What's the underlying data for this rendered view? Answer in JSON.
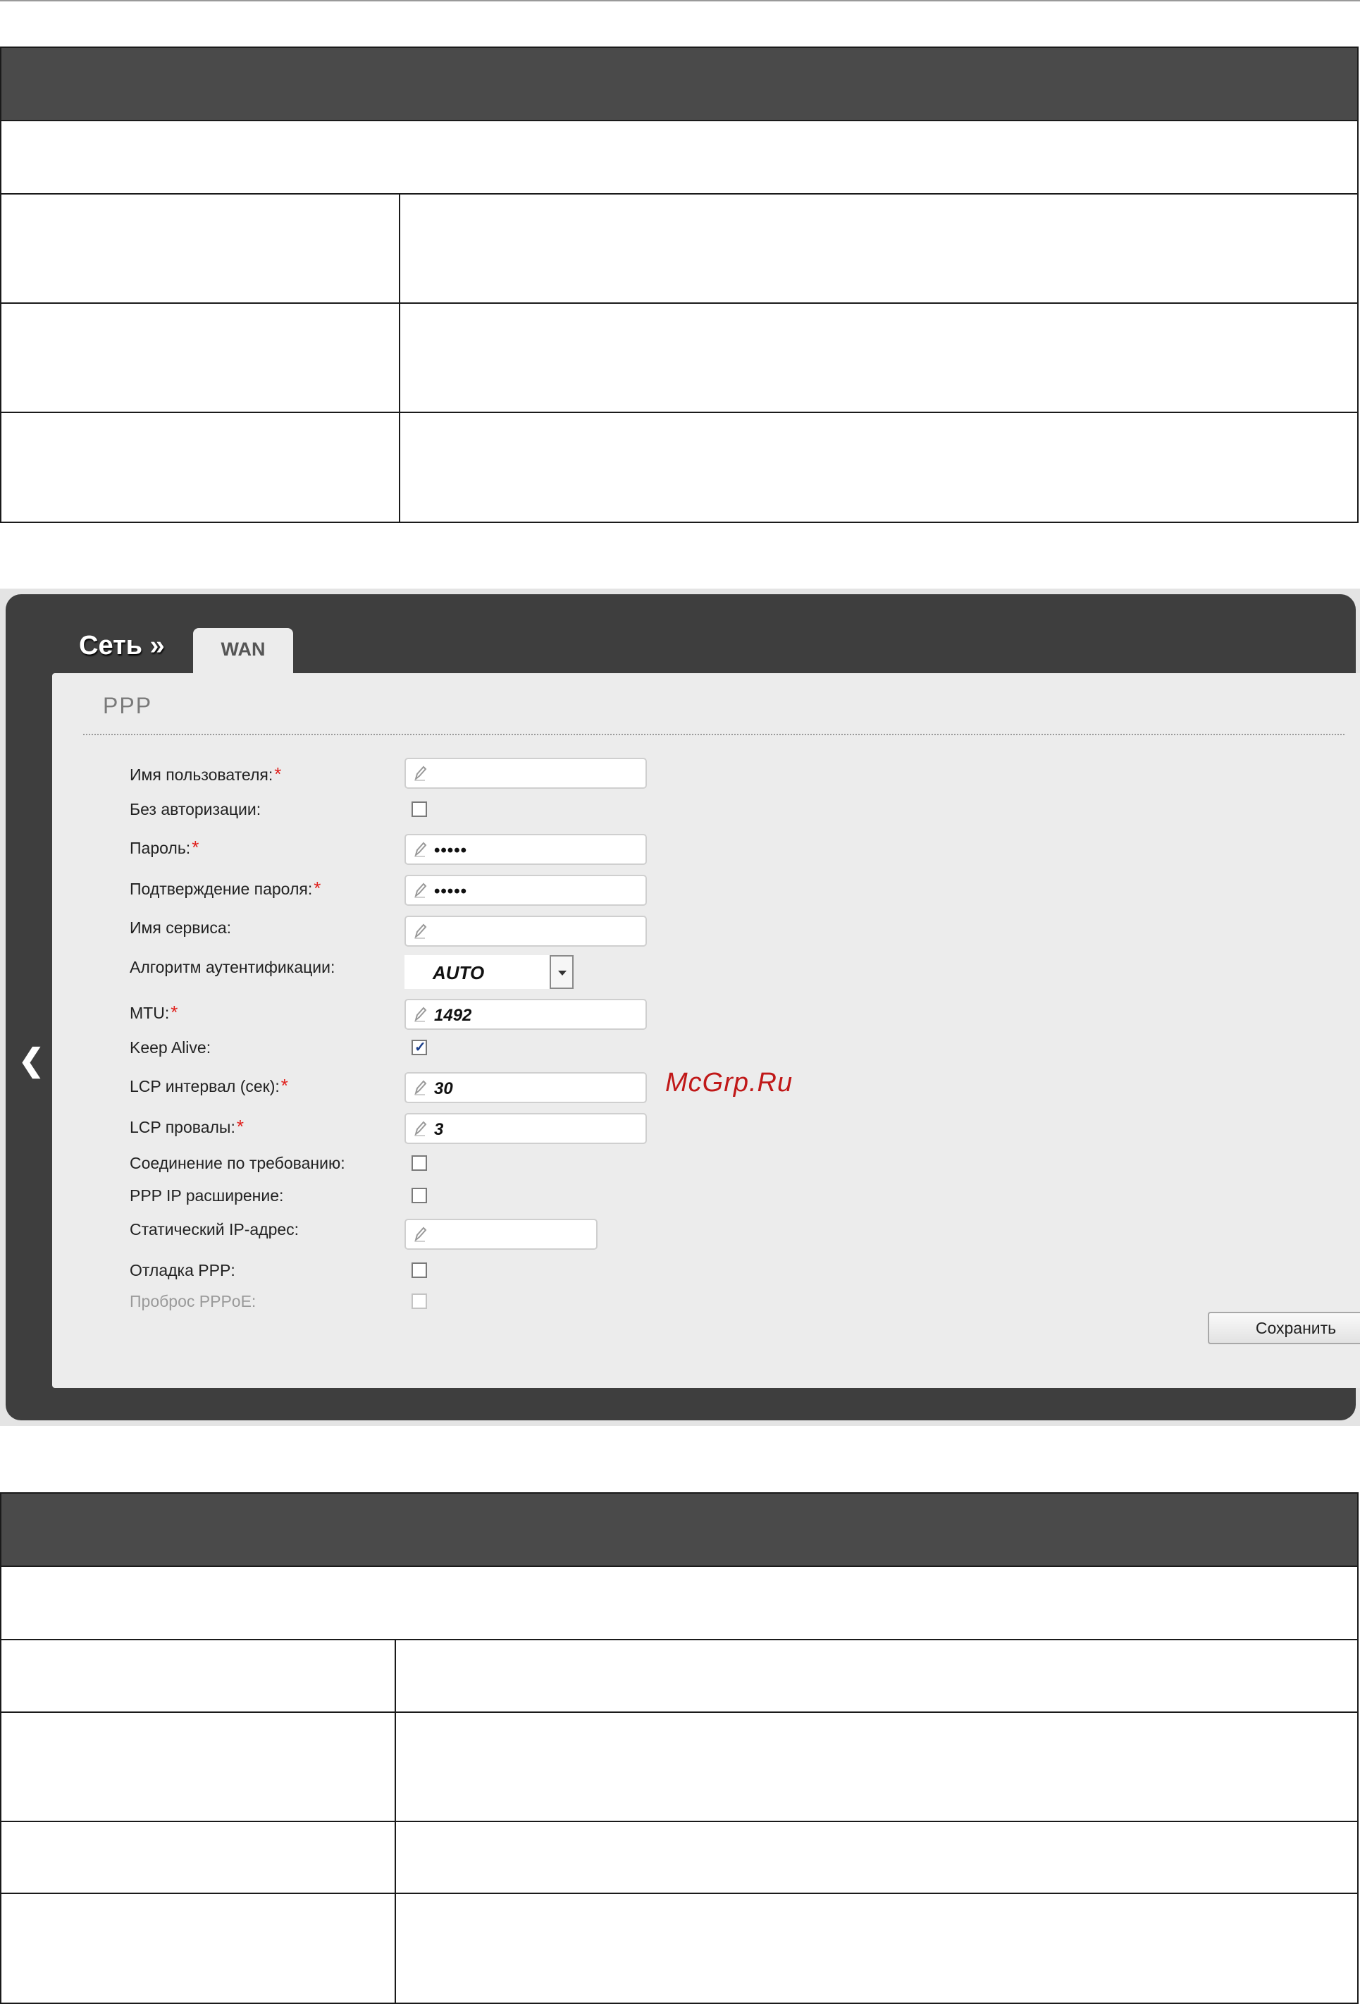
{
  "breadcrumb": {
    "section": "Сеть »",
    "tab": "WAN"
  },
  "panel": {
    "title": "PPP"
  },
  "fields": {
    "username": {
      "label": "Имя пользователя:",
      "value": ""
    },
    "no_auth": {
      "label": "Без авторизации:",
      "checked": false
    },
    "password": {
      "label": "Пароль:",
      "value": "•••••"
    },
    "password_confirm": {
      "label": "Подтверждение пароля:",
      "value": "•••••"
    },
    "service_name": {
      "label": "Имя сервиса:",
      "value": ""
    },
    "auth_algorithm": {
      "label": "Алгоритм аутентификации:",
      "value": "AUTO"
    },
    "mtu": {
      "label": "MTU:",
      "value": "1492"
    },
    "keep_alive": {
      "label": "Keep Alive:",
      "checked": true
    },
    "lcp_interval": {
      "label": "LCP интервал (сек):",
      "value": "30"
    },
    "lcp_fails": {
      "label": "LCP провалы:",
      "value": "3"
    },
    "on_demand": {
      "label": "Соединение по требованию:",
      "checked": false
    },
    "ppp_ip_ext": {
      "label": "PPP IP расширение:",
      "checked": false
    },
    "static_ip": {
      "label": "Статический IP-адрес:",
      "value": ""
    },
    "ppp_debug": {
      "label": "Отладка PPP:",
      "checked": false
    },
    "pppoe_passthrough": {
      "label": "Проброс PPPoE:",
      "checked": false
    }
  },
  "required_mark": "*",
  "save_label": "Сохранить",
  "watermark": "McGrp.Ru",
  "icons": {
    "collapse": "chevron-left-icon",
    "edit": "pencil-icon",
    "dropdown": "caret-down-icon"
  },
  "colors": {
    "header_bar": "#4a4a4a",
    "frame_dark": "#3e3e3e",
    "panel_bg": "#ececec",
    "required": "#e0201c",
    "watermark": "#c01818"
  }
}
